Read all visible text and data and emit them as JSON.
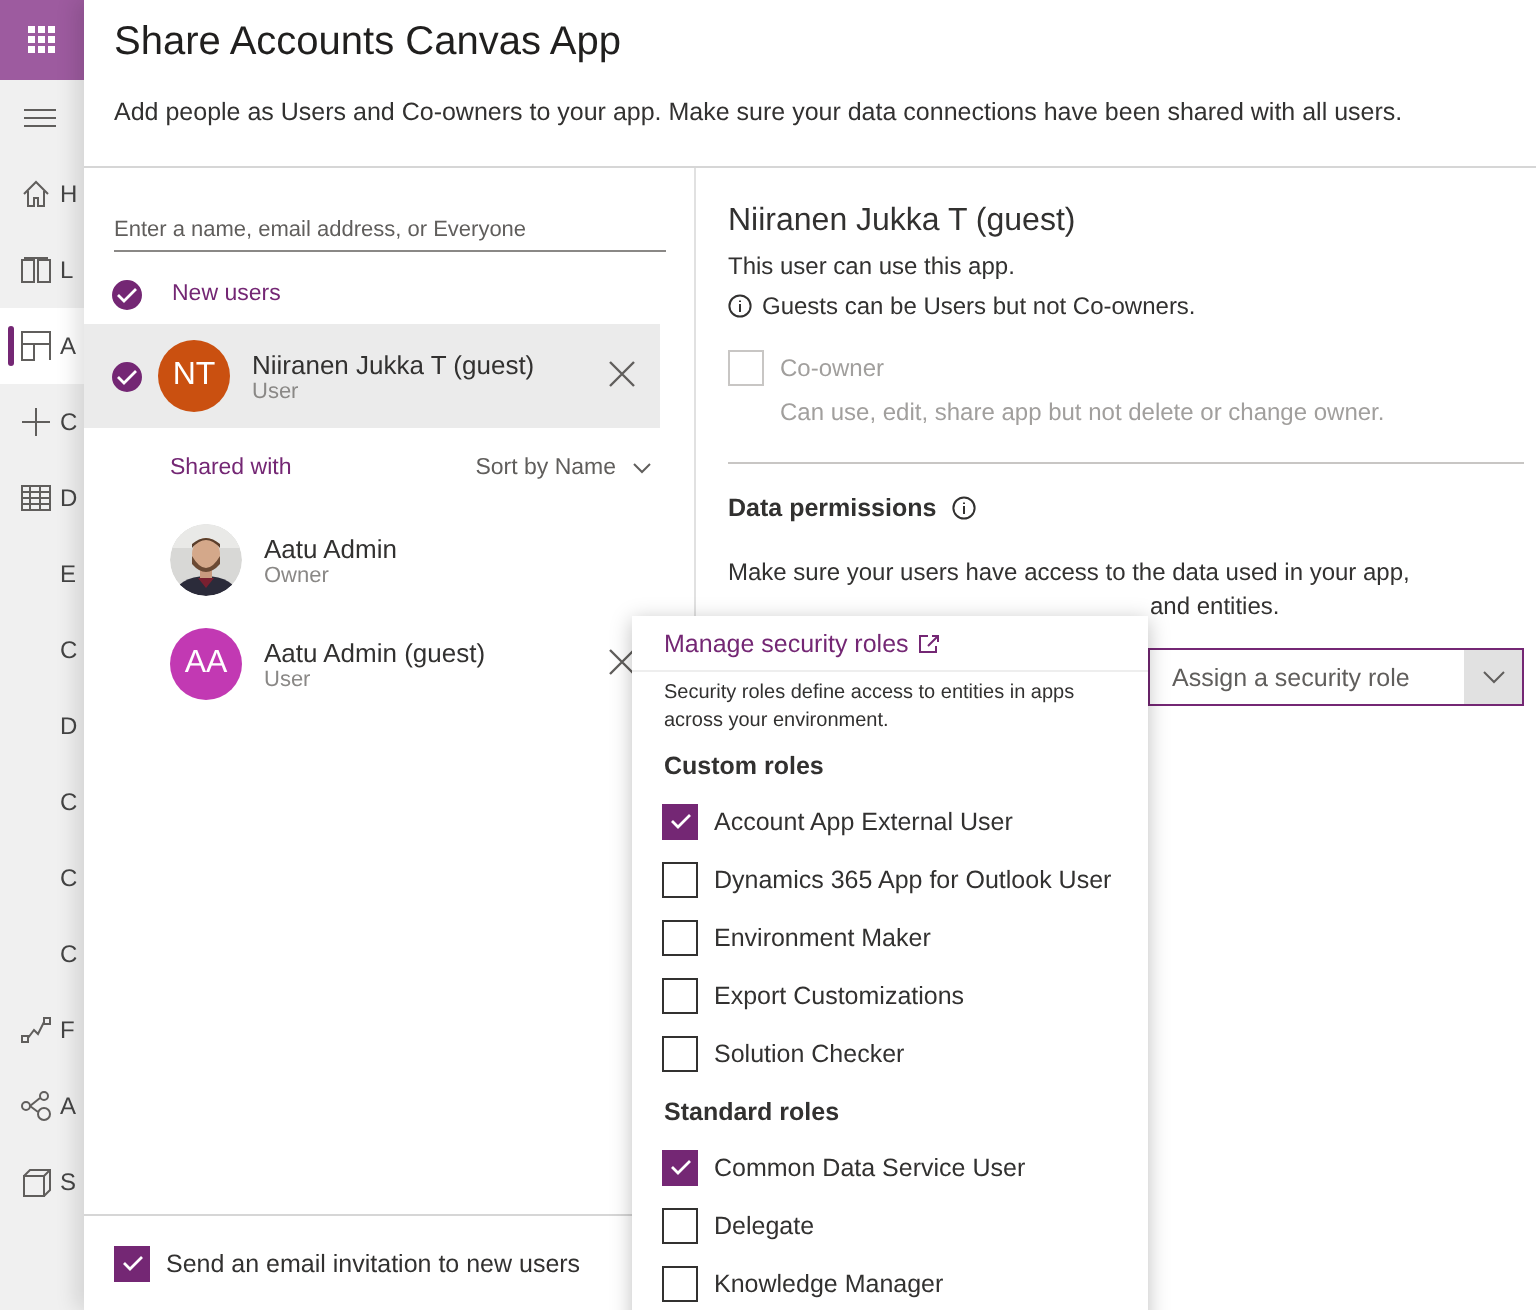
{
  "sidebar": {
    "items": [
      {
        "label": "H",
        "selected": false
      },
      {
        "label": "L",
        "selected": false
      },
      {
        "label": "A",
        "selected": true
      },
      {
        "label": "C",
        "selected": false
      },
      {
        "label": "D",
        "selected": false
      },
      {
        "label": "E",
        "selected": false
      },
      {
        "label": "C",
        "selected": false
      },
      {
        "label": "D",
        "selected": false
      },
      {
        "label": "C",
        "selected": false
      },
      {
        "label": "C",
        "selected": false
      },
      {
        "label": "C",
        "selected": false
      },
      {
        "label": "F",
        "selected": false
      },
      {
        "label": "A",
        "selected": false
      },
      {
        "label": "S",
        "selected": false
      }
    ]
  },
  "dialog": {
    "title": "Share Accounts Canvas App",
    "subtitle": "Add people as Users and Co-owners to your app. Make sure your data connections have been shared with all users.",
    "search": {
      "placeholder": "Enter a name, email address, or Everyone"
    },
    "new_users": {
      "label": "New users",
      "checked": true,
      "users": [
        {
          "initials": "NT",
          "name": "Niiranen Jukka T (guest)",
          "role": "User",
          "color": "#ca5010",
          "checked": true,
          "selected": true
        }
      ]
    },
    "shared_with": {
      "label": "Shared with",
      "sort": "Sort by Name",
      "users": [
        {
          "name": "Aatu Admin",
          "role": "Owner",
          "removable": false
        },
        {
          "kind": "initials",
          "initials": "AA",
          "color": "#c239b3",
          "name": "Aatu Admin (guest)",
          "role": "User",
          "removable": true
        }
      ]
    },
    "email_invite": {
      "label": "Send an email invitation to new users",
      "checked": true
    },
    "details": {
      "name": "Niiranen Jukka T (guest)",
      "note": "This user can use this app.",
      "info": "Guests can be Users but not Co-owners.",
      "co_owner": {
        "label": "Co-owner",
        "description": "Can use, edit, share app but not delete or change owner.",
        "checked": false,
        "disabled": true
      },
      "data_permissions": {
        "title": "Data permissions",
        "line_1": "Make sure your users have access to the data used in your app,",
        "line_2_visible": "and entities.",
        "dropdown": {
          "placeholder": "Assign a security role",
          "open": true
        }
      }
    },
    "roles_popup": {
      "link": "Manage security roles",
      "description": "Security roles define access to entities in apps across your environment.",
      "groups": [
        {
          "title": "Custom roles",
          "roles": [
            {
              "label": "Account App External User",
              "checked": true
            },
            {
              "label": "Dynamics 365 App for Outlook User",
              "checked": false
            },
            {
              "label": "Environment Maker",
              "checked": false
            },
            {
              "label": "Export Customizations",
              "checked": false
            },
            {
              "label": "Solution Checker",
              "checked": false
            }
          ]
        },
        {
          "title": "Standard roles",
          "roles": [
            {
              "label": "Common Data Service User",
              "checked": true
            },
            {
              "label": "Delegate",
              "checked": false
            },
            {
              "label": "Knowledge Manager",
              "checked": false
            }
          ]
        }
      ]
    }
  }
}
